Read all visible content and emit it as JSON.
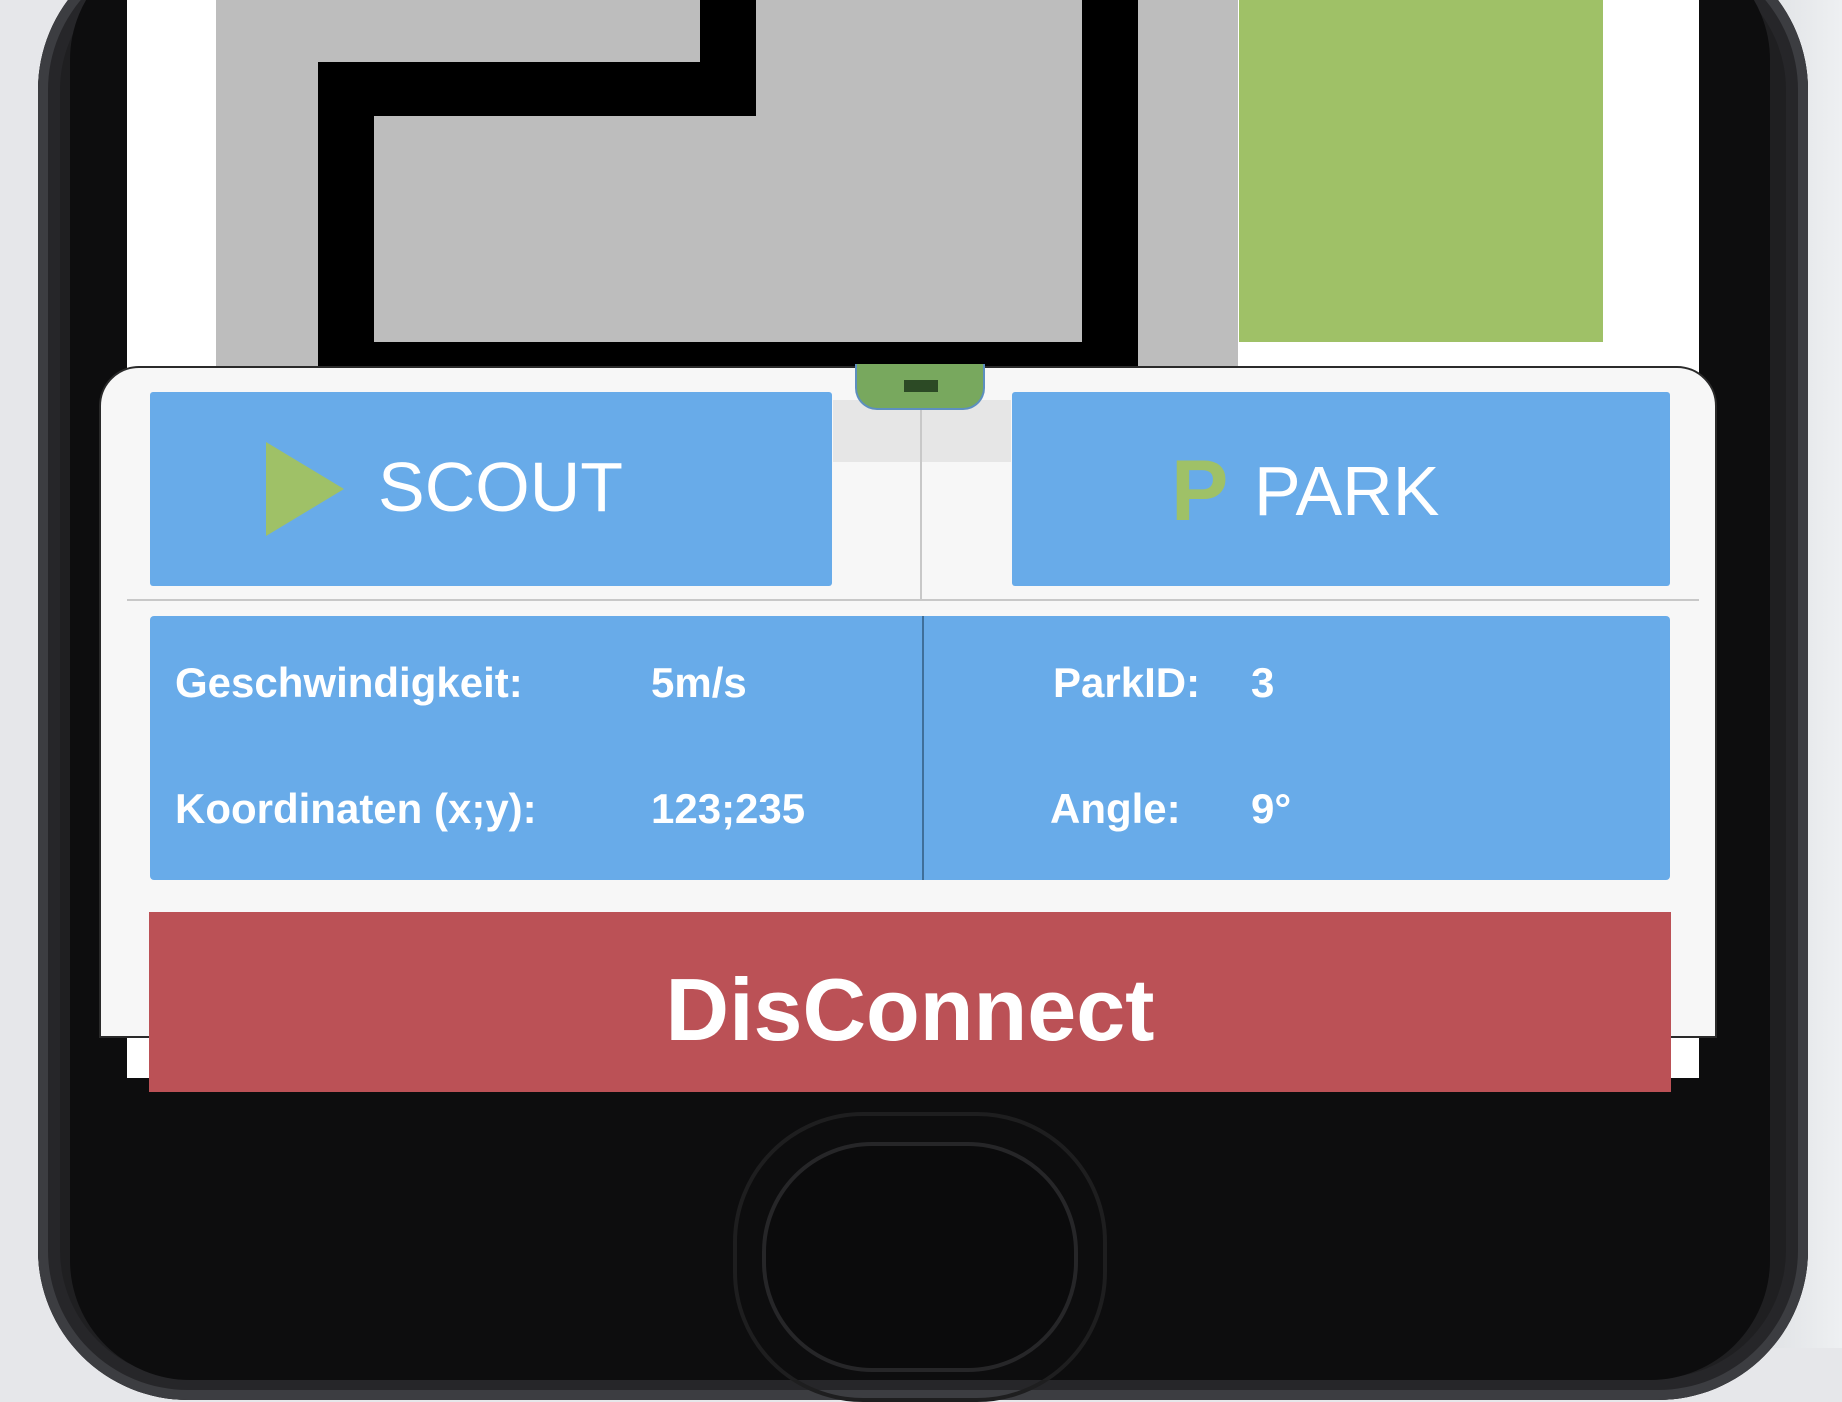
{
  "colors": {
    "button_blue": "#68abe9",
    "accent_green": "#9fc167",
    "danger_red": "#bb5156",
    "map_gray": "#bdbdbd",
    "phone_body": "#0d0d0e"
  },
  "map": {
    "tiles": [
      "road-path",
      "parking-area"
    ]
  },
  "bottom_sheet": {
    "handle_icon": "drag-handle-icon",
    "scout_button": {
      "label": "SCOUT",
      "icon": "play-icon"
    },
    "park_button": {
      "label": "PARK",
      "icon": "parking-icon",
      "icon_glyph": "P"
    },
    "info": {
      "speed_label": "Geschwindigkeit:",
      "speed_value": "5m/s",
      "coords_label": "Koordinaten (x;y):",
      "coords_value": "123;235",
      "parkid_label": "ParkID:",
      "parkid_value": "3",
      "angle_label": "Angle:",
      "angle_value": "9°"
    },
    "disconnect_button": {
      "label": "DisConnect"
    }
  },
  "device": {
    "home_button_icon": "home-button-icon"
  }
}
